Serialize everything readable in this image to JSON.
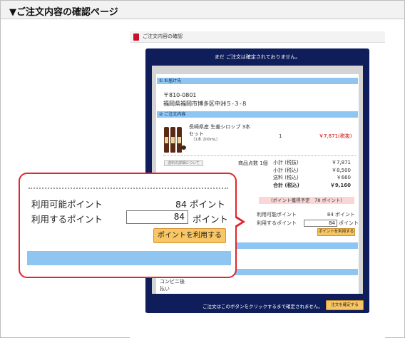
{
  "page": {
    "title": "▼ご注文内容の確認ページ"
  },
  "background_page": {
    "header_label": "ご注文内容の確認",
    "top_notice": "まだ ご注文は確定されておりません。",
    "shipping": {
      "section_label": "① お届け先",
      "postal": "〒810-0801",
      "address": "福岡県福岡市博多区中洲５-３-８"
    },
    "order": {
      "section_label": "② ご注文内容",
      "product_name_line1": "長崎県産 生姜シロップ 3本",
      "product_name_line2": "セット",
      "product_note": "（1本 200mL）",
      "quantity": "1",
      "price": "￥7,871(税抜)",
      "detail_button": "送料の詳細について",
      "item_count": "商品点数 1個",
      "summary": [
        {
          "label": "小計 (税抜)",
          "value": "￥7,871"
        },
        {
          "label": "小計 (税込)",
          "value": "￥8,500"
        },
        {
          "label": "送料 (税込)",
          "value": "￥660"
        },
        {
          "label": "合計 (税込)",
          "value": "￥9,160"
        }
      ]
    },
    "points": {
      "planned": "（ポイント獲得予定　78 ポイント）",
      "available_label": "利用可能ポイント",
      "available_value": "84 ポイント",
      "use_label": "利用するポイント",
      "use_value": "84",
      "use_unit": "ポイント",
      "use_button": "ポイントを利用する"
    },
    "payment": {
      "line1": "コンビニ後",
      "line2": "払い"
    },
    "bottom_message": "ご注文はこのボタンをクリックするまで確定されません。",
    "confirm_button": "注文を確定する"
  },
  "callout": {
    "available_label": "利用可能ポイント",
    "available_value": "84 ポイント",
    "use_label": "利用するポイント",
    "use_value": "84",
    "use_unit": "ポイント",
    "use_button": "ポイントを利用する"
  },
  "colors": {
    "navy": "#0f1d5a",
    "section_blue": "#8ec6f1",
    "button_orange": "#f9c565",
    "callout_red": "#e0262e",
    "price_red": "#d40000"
  }
}
